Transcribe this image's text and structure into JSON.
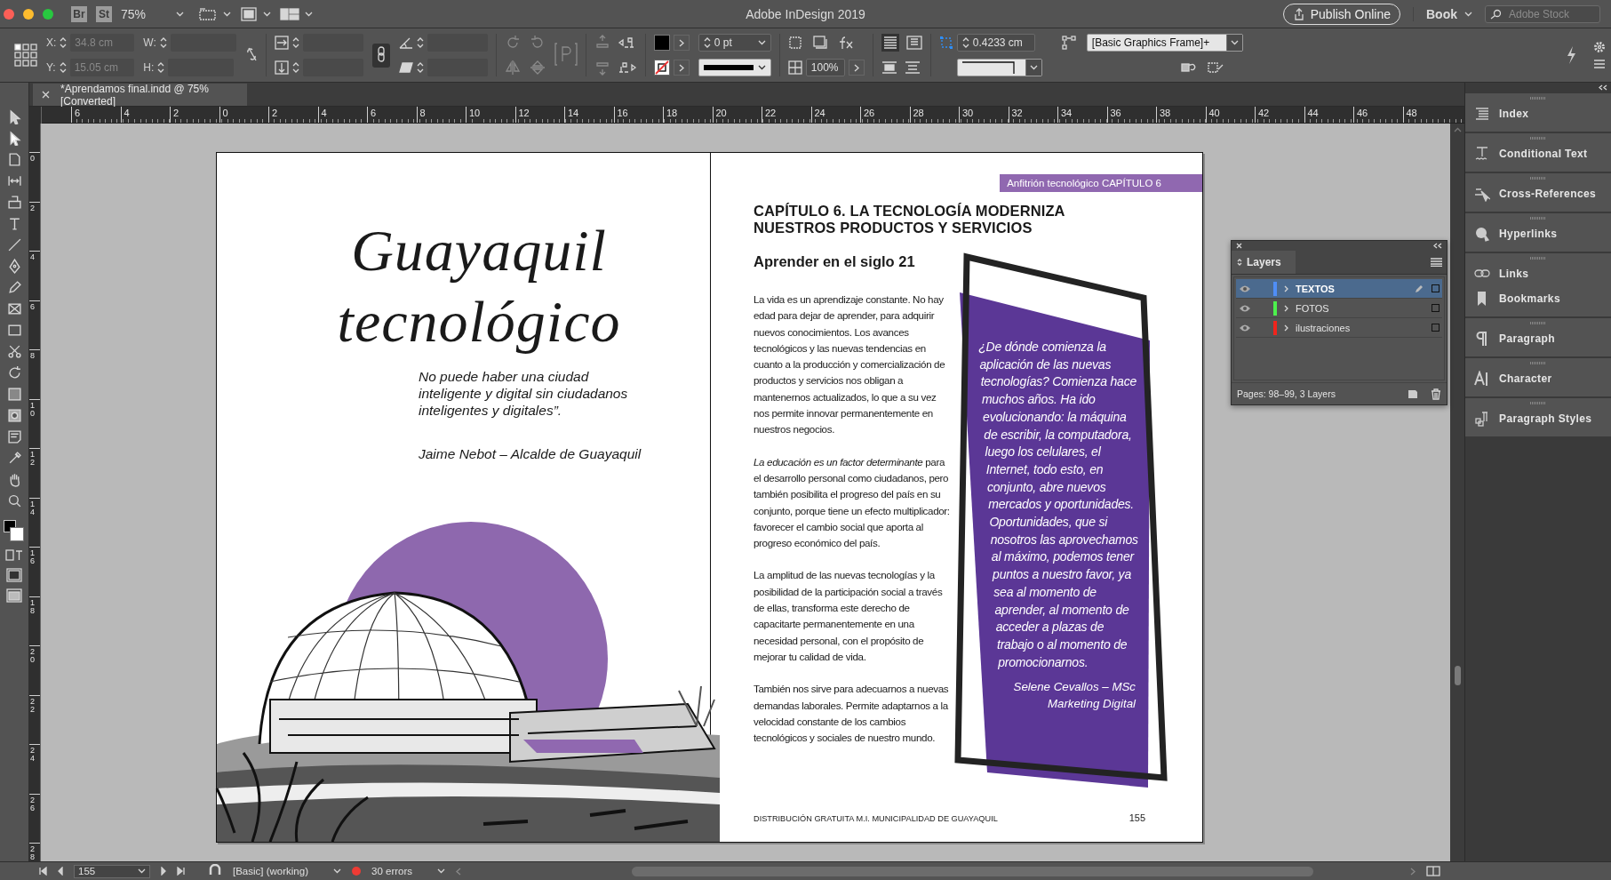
{
  "app": {
    "title": "Adobe InDesign 2019",
    "bridge": "Br",
    "stock": "St",
    "zoom": "75%",
    "publish_button": "Publish Online",
    "workspace": "Book",
    "search": {
      "placeholder": "Adobe Stock"
    }
  },
  "control_panel": {
    "x_label": "X:",
    "x_value": "34.8 cm",
    "y_label": "Y:",
    "y_value": "15.05 cm",
    "w_label": "W:",
    "h_label": "H:",
    "stroke_weight": "0 pt",
    "opacity": "100%",
    "frame_spacing": "0.4233 cm",
    "object_style": "[Basic Graphics Frame]+"
  },
  "document_tab": {
    "title": "*Aprendamos final.indd @ 75% [Converted]"
  },
  "rulers": {
    "horizontal": [
      "6",
      "4",
      "2",
      "0",
      "2",
      "4",
      "6",
      "8",
      "10",
      "12",
      "14",
      "16",
      "18",
      "20",
      "22",
      "24",
      "26",
      "28",
      "30",
      "32",
      "34",
      "36",
      "38",
      "40",
      "42",
      "44",
      "46",
      "48"
    ],
    "vertical": [
      "0",
      "2",
      "4",
      "6",
      "8",
      "10",
      "12",
      "14",
      "16",
      "18",
      "20",
      "22",
      "24",
      "26",
      "28"
    ]
  },
  "spread": {
    "left_page": {
      "title": "Guayaquil tecnológico",
      "quote": "No puede haber una ciudad inteligente y digital sin ciudadanos inteligentes y digitales”.",
      "author": "Jaime Nebot – Alcalde de Guayaquil"
    },
    "right_page": {
      "header": "Anfitrión tecnológico CAPÍTULO 6",
      "heading": "CAPÍTULO 6. LA TECNOLOGÍA MODERNIZA NUESTROS PRODUCTOS Y SERVICIOS",
      "subheading": "Aprender en el siglo 21",
      "paragraphs": [
        "La vida es un aprendizaje constante. No hay edad para dejar de aprender, para adquirir nuevos conocimientos. Los avances tecnológicos y las nuevas tendencias en cuanto a la producción y comercialización de productos y servicios nos obligan a mantenernos actualizados, lo que a su vez nos permite innovar permanentemente en nuestros negocios.",
        "*La educación es un factor determinante* para el desarrollo personal como ciudadanos, pero también posibilita el progreso del país en su conjunto, porque tiene un efecto multiplicador: favorecer el cambio social que aporta al progreso económico del país.",
        "La amplitud de las nuevas tecnologías y la posibilidad de la participación social a través de ellas, transforma este derecho de capacitarte permanentemente en una necesidad personal, con el propósito de mejorar tu calidad de vida.",
        "También nos sirve para adecuarnos a nuevas demandas laborales. Permite adaptarnos a la velocidad constante de los cambios tecnológicos y sociales de nuestro mundo."
      ],
      "pull_quote": "¿De dónde comienza la aplicación de las nuevas tecnologías? Comienza hace muchos años. Ha ido evolucionando: la máquina de escribir, la computadora, luego los celulares, el Internet, todo esto, en conjunto, abre nuevos mercados y oportunidades. Oportunidades, que si nosotros las aprovechamos al máximo, podemos tener puntos a nuestro favor, ya sea al momento de aprender, al momento de acceder a plazas de trabajo o al momento de promocionarnos.",
      "attribution": [
        "Selene Cevallos – MSc",
        "Marketing Digital"
      ],
      "footer": "DISTRIBUCIÓN GRATUITA M.I. MUNICIPALIDAD DE GUAYAQUIL",
      "page_number": "155"
    }
  },
  "layers_panel": {
    "title": "Layers",
    "layers": [
      {
        "name": "TEXTOS",
        "color": "#4f8ef7",
        "selected": true,
        "visible": true
      },
      {
        "name": "FOTOS",
        "color": "#4cf04c",
        "selected": false,
        "visible": true
      },
      {
        "name": "ilustraciones",
        "color": "#f0241c",
        "selected": false,
        "visible": true
      }
    ],
    "footer": "Pages: 98–99, 3 Layers"
  },
  "dock": {
    "groups": [
      [
        "Index"
      ],
      [
        "Conditional Text"
      ],
      [
        "Cross-References"
      ],
      [
        "Hyperlinks"
      ],
      [
        "Links",
        "Bookmarks"
      ],
      [
        "Paragraph"
      ],
      [
        "Character"
      ],
      [
        "Paragraph Styles"
      ]
    ]
  },
  "status_bar": {
    "page": "155",
    "preflight_profile": "[Basic] (working)",
    "errors": "30 errors"
  }
}
